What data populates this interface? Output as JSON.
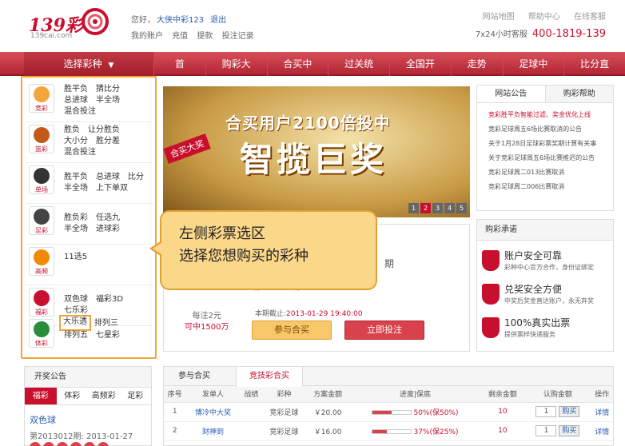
{
  "header": {
    "logo_text": "139彩",
    "logo_sub": "139cai.com",
    "greeting": "您好，",
    "username": "大侠中彩123",
    "logout": "退出",
    "my_account": "我的账户",
    "recharge": "充值",
    "withdraw": "提款",
    "bet_record": "投注记录",
    "site_map": "网站地图",
    "help_center": "帮助中心",
    "online_service": "在线客服",
    "hotline_label": "7x24小时客服",
    "hotline_number": "400-1819-139"
  },
  "nav": {
    "select": "选择彩种",
    "items": [
      "首　页",
      "购彩大厅",
      "合买中心",
      "过关统计",
      "全国开奖",
      "走势图",
      "足球中心",
      "比分直播"
    ]
  },
  "sidebar": [
    {
      "icon": "竞彩",
      "lines": [
        "胜平负　猜比分",
        "总进球　半全场",
        "混合投注"
      ]
    },
    {
      "icon": "篮彩",
      "lines": [
        "胜负　让分胜负",
        "大小分　胜分差",
        "混合投注"
      ]
    },
    {
      "icon": "单场",
      "lines": [
        "胜平负　总进球　比分",
        "半全场　上下单双"
      ]
    },
    {
      "icon": "足彩",
      "lines": [
        "胜负彩　任选九",
        "半全场　进球彩"
      ]
    },
    {
      "icon": "高频",
      "lines": [
        "11选5"
      ]
    },
    {
      "icon": "福彩",
      "lines": [
        "双色球　福彩3D",
        "七乐彩"
      ]
    },
    {
      "icon": "体彩",
      "lines": [
        "大乐透",
        "排列三",
        "排列五　七星彩"
      ]
    }
  ],
  "banner": {
    "line1": "合买用户2100倍投中",
    "line2": "智揽巨奖",
    "badge": "合买大奖",
    "pages": [
      "1",
      "2",
      "3",
      "4",
      "5"
    ]
  },
  "promo": {
    "price": "每注2元",
    "win": "可中1500万",
    "deadline_label": "本期截止:",
    "deadline": "2013-01-29 19:40:00",
    "join": "参与合买",
    "buy": "立即投注",
    "issue_suffix": "期",
    "issue_ghost": "第2013011期"
  },
  "tooltip": {
    "line1": "左侧彩票选区",
    "line2": "选择您想购买的彩种"
  },
  "notice": {
    "tab1": "网站公告",
    "tab2": "购彩帮助",
    "items": [
      "竞彩胜平负智能过滤、奖金优化上线",
      "竞彩足球周五6场比赛取消的公告",
      "关于1月28日足球彩票奖期计算有关事",
      "关于竞彩足球周五6场比赛推迟的公告",
      "竞彩足球周二013比赛取消",
      "竞彩足球周二006比赛取消"
    ]
  },
  "promise": {
    "title": "购彩承诺",
    "items": [
      {
        "title": "账户安全可靠",
        "desc": "彩种中心官方合作，身份证绑定"
      },
      {
        "title": "兑奖安全方便",
        "desc": "中奖后奖金直达账户，永无弃奖"
      },
      {
        "title": "100%真实出票",
        "desc": "提供票样快递服务"
      }
    ]
  },
  "draw": {
    "title": "开奖公告",
    "tabs": [
      "福彩",
      "体彩",
      "高频彩",
      "足彩"
    ],
    "game": "双色球",
    "issue": "第2013012期: 2013-01-27"
  },
  "hall": {
    "tab1": "参与合买",
    "tab2": "竞技彩合买",
    "columns": [
      "序号",
      "发单人",
      "战绩",
      "彩种",
      "方案金额",
      "进度|保底",
      "剩余金额",
      "认购金额",
      "操作"
    ],
    "rows": [
      {
        "no": "1",
        "user": "博冷中大奖",
        "lottery": "竞彩足球",
        "amount": "￥20.00",
        "progress": "50%(保50%)",
        "pct": 50,
        "remain": "10",
        "qty": "1",
        "buy": "购买",
        "op": "详情"
      },
      {
        "no": "2",
        "user": "财神到",
        "lottery": "竞彩足球",
        "amount": "￥16.00",
        "progress": "37%(保25%)",
        "pct": 37,
        "remain": "10",
        "qty": "1",
        "buy": "购买",
        "op": "详情"
      }
    ]
  },
  "colors": {
    "brand": "#c8102e",
    "nav": "#b32533",
    "highlight": "#f2a53a",
    "tooltip_bg": "#fbd78a"
  }
}
